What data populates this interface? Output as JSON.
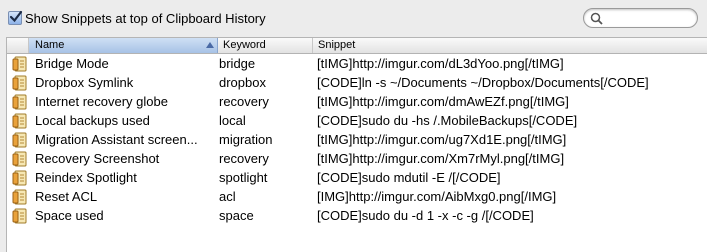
{
  "header": {
    "show_snippets_label": "Show Snippets at top of Clipboard History",
    "search_placeholder": ""
  },
  "table": {
    "columns": [
      "Name",
      "Keyword",
      "Snippet"
    ],
    "sorted_column": "Name",
    "sort_direction": "ascending",
    "rows": [
      {
        "name": "Bridge Mode",
        "keyword": "bridge",
        "snippet": "[tIMG]http://imgur.com/dL3dYoo.png[/tIMG]"
      },
      {
        "name": "Dropbox Symlink",
        "keyword": "dropbox",
        "snippet": "[CODE]ln -s ~/Documents ~/Dropbox/Documents[/CODE]"
      },
      {
        "name": "Internet recovery globe",
        "keyword": "recovery",
        "snippet": "[tIMG]http://imgur.com/dmAwEZf.png[/tIMG]"
      },
      {
        "name": "Local backups used",
        "keyword": "local",
        "snippet": "[CODE]sudo du -hs /.MobileBackups[/CODE]"
      },
      {
        "name": "Migration Assistant screen...",
        "keyword": "migration",
        "snippet": "[tIMG]http://imgur.com/ug7Xd1E.png[/tIMG]"
      },
      {
        "name": "Recovery Screenshot",
        "keyword": "recovery",
        "snippet": "[tIMG]http://imgur.com/Xm7rMyl.png[/tIMG]"
      },
      {
        "name": "Reindex Spotlight",
        "keyword": "spotlight",
        "snippet": "[CODE]sudo mdutil -E /[/CODE]"
      },
      {
        "name": "Reset ACL",
        "keyword": "acl",
        "snippet": "[IMG]http://imgur.com/AibMxg0.png[/IMG]"
      },
      {
        "name": "Space used",
        "keyword": "space",
        "snippet": "[CODE]sudo du -d 1 -x -c -g /[/CODE]"
      }
    ]
  },
  "colors": {
    "accent": "#a7c2e6",
    "checkbox": "#8db2e8"
  },
  "icons": {
    "row": "snippet-note-icon",
    "search": "search-icon"
  }
}
